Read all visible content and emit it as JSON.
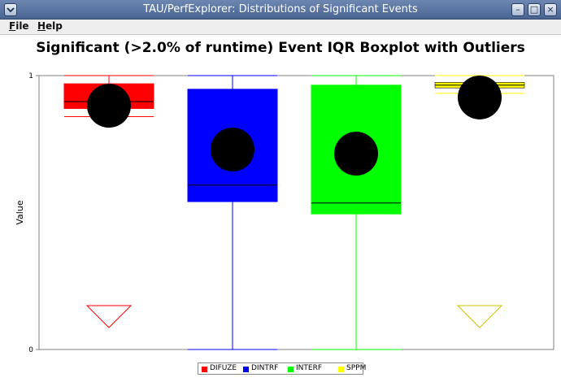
{
  "window": {
    "title": "TAU/PerfExplorer: Distributions of Significant Events",
    "minimize_glyph": "–",
    "maximize_glyph": "□",
    "close_glyph": "×",
    "menu_icon": "chevron-down-icon"
  },
  "menu": {
    "file": {
      "underlined": "F",
      "rest": "ile"
    },
    "help": {
      "underlined": "H",
      "rest": "elp"
    }
  },
  "chart_data": {
    "type": "boxplot",
    "title": "Significant (>2.0% of runtime) Event IQR Boxplot with Outliers",
    "xlabel": "",
    "ylabel": "Value",
    "ylim": [
      0,
      1
    ],
    "yticks": [
      "0",
      "1"
    ],
    "grid": false,
    "legend_position": "bottom",
    "series": [
      {
        "name": "DIFUZE",
        "color": "#ff0000",
        "min": 0.85,
        "q1": 0.88,
        "median": 0.905,
        "q3": 0.97,
        "max": 1.0,
        "mean": 0.89,
        "outliers_low": [
          0.08
        ]
      },
      {
        "name": "DINTRF",
        "color": "#0000ff",
        "min": 0.0,
        "q1": 0.54,
        "median": 0.6,
        "q3": 0.95,
        "max": 1.0,
        "mean": 0.73
      },
      {
        "name": "INTERF",
        "color": "#00ff00",
        "min": 0.0,
        "q1": 0.495,
        "median": 0.535,
        "q3": 0.965,
        "max": 1.0,
        "mean": 0.715
      },
      {
        "name": "SPPM",
        "color": "#ffff00",
        "min": 0.935,
        "q1": 0.955,
        "median": 0.965,
        "q3": 0.975,
        "max": 1.0,
        "mean": 0.92,
        "outliers_low": [
          0.08
        ]
      }
    ]
  }
}
